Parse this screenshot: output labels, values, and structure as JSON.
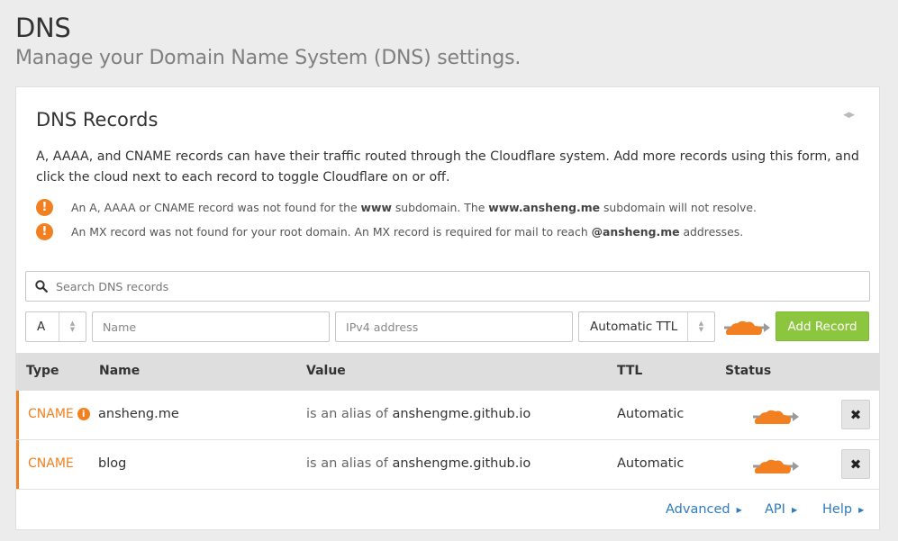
{
  "page": {
    "title": "DNS",
    "subtitle": "Manage your Domain Name System (DNS) settings."
  },
  "card": {
    "title": "DNS Records",
    "intro": "A, AAAA, and CNAME records can have their traffic routed through the Cloudflare system. Add more records using this form, and click the cloud next to each record to toggle Cloudflare on or off.",
    "warnings": [
      {
        "icon": "exclamation-icon",
        "p1": "An A, AAAA or CNAME record was not found for the ",
        "b1": "www",
        "p2": " subdomain. The ",
        "b2": "www.ansheng.me",
        "p3": " subdomain will not resolve."
      },
      {
        "icon": "exclamation-icon",
        "p1": "An MX record was not found for your root domain. An MX record is required for mail to reach ",
        "b1": "@ansheng.me",
        "p2": " addresses."
      }
    ]
  },
  "search": {
    "placeholder": "Search DNS records"
  },
  "form": {
    "type_value": "A",
    "name_placeholder": "Name",
    "value_placeholder": "IPv4 address",
    "ttl_value": "Automatic TTL",
    "add_label": "Add Record"
  },
  "table": {
    "headers": {
      "type": "Type",
      "name": "Name",
      "value": "Value",
      "ttl": "TTL",
      "status": "Status"
    },
    "rows": [
      {
        "type": "CNAME",
        "name": "ansheng.me",
        "value_prefix": "is an alias of ",
        "value": "anshengme.github.io",
        "ttl": "Automatic",
        "proxied": true,
        "has_info": true
      },
      {
        "type": "CNAME",
        "name": "blog",
        "value_prefix": "is an alias of ",
        "value": "anshengme.github.io",
        "ttl": "Automatic",
        "proxied": true,
        "has_info": false
      }
    ]
  },
  "footer": {
    "advanced": "Advanced",
    "api": "API",
    "help": "Help"
  },
  "colors": {
    "accent_orange": "#f38020",
    "add_green": "#8cc63f",
    "link_blue": "#2f7bbf"
  }
}
